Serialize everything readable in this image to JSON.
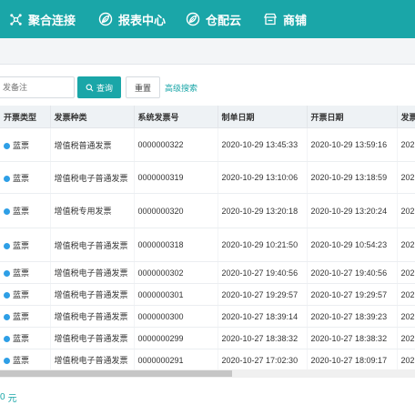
{
  "nav": {
    "items": [
      {
        "label": "聚合连接",
        "icon": "network-icon"
      },
      {
        "label": "报表中心",
        "icon": "leaf-icon"
      },
      {
        "label": "仓配云",
        "icon": "leaf-icon"
      },
      {
        "label": "商铺",
        "icon": "store-icon"
      }
    ]
  },
  "search": {
    "placeholder": "发备注",
    "query_label": "查询",
    "reset_label": "重置",
    "advanced_label": "高级搜索"
  },
  "table": {
    "columns": [
      "开票类型",
      "发票种类",
      "系统发票号",
      "制单日期",
      "开票日期",
      "发票"
    ],
    "rows": [
      {
        "type": "蓝票",
        "kind": "增值税普通发票",
        "no": "0000000322",
        "made": "2020-10-29 13:45:33",
        "issued": "2020-10-29 13:59:16",
        "more": "202"
      },
      {
        "type": "蓝票",
        "kind": "增值税电子普通发票",
        "no": "0000000319",
        "made": "2020-10-29 13:10:06",
        "issued": "2020-10-29 13:18:59",
        "more": "202"
      },
      {
        "type": "蓝票",
        "kind": "增值税专用发票",
        "no": "0000000320",
        "made": "2020-10-29 13:20:18",
        "issued": "2020-10-29 13:20:24",
        "more": "202"
      },
      {
        "type": "蓝票",
        "kind": "增值税电子普通发票",
        "no": "0000000318",
        "made": "2020-10-29 10:21:50",
        "issued": "2020-10-29 10:54:23",
        "more": "202"
      },
      {
        "type": "蓝票",
        "kind": "增值税电子普通发票",
        "no": "0000000302",
        "made": "2020-10-27 19:40:56",
        "issued": "2020-10-27 19:40:56",
        "more": "202"
      },
      {
        "type": "蓝票",
        "kind": "增值税电子普通发票",
        "no": "0000000301",
        "made": "2020-10-27 19:29:57",
        "issued": "2020-10-27 19:29:57",
        "more": "202"
      },
      {
        "type": "蓝票",
        "kind": "增值税电子普通发票",
        "no": "0000000300",
        "made": "2020-10-27 18:39:14",
        "issued": "2020-10-27 18:39:23",
        "more": "202"
      },
      {
        "type": "蓝票",
        "kind": "增值税电子普通发票",
        "no": "0000000299",
        "made": "2020-10-27 18:38:32",
        "issued": "2020-10-27 18:38:32",
        "more": "202"
      },
      {
        "type": "蓝票",
        "kind": "增值税电子普通发票",
        "no": "0000000291",
        "made": "2020-10-27 17:02:30",
        "issued": "2020-10-27 18:09:17",
        "more": "202"
      }
    ]
  },
  "footer": {
    "amount": "0",
    "unit": "元"
  },
  "colors": {
    "accent": "#1aa6a8",
    "badge": "#2e9fe6"
  }
}
